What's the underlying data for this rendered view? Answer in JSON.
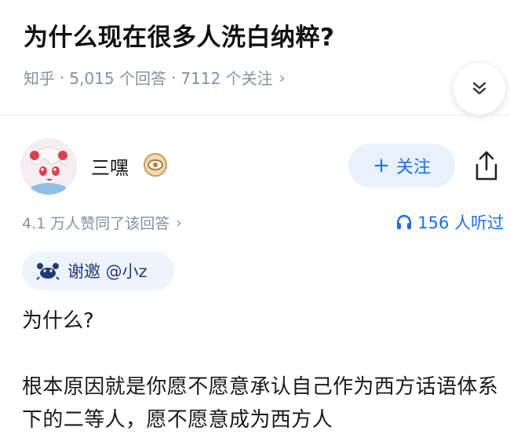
{
  "question": {
    "title": "为什么现在很多人洗白纳粹?",
    "source": "知乎",
    "answers_count": "5,015 个回答",
    "followers": "7112 个关注"
  },
  "author": {
    "name": "三嘿",
    "follow_label": "关注"
  },
  "answer": {
    "approvals": "4.1 万人赞同了该回答",
    "listeners": "156 人听过",
    "invite": "谢邀 @小z",
    "paragraphs": [
      "为什么?",
      "根本原因就是你愿不愿意承认自己作为西方话语体系下的二等人，愿不愿意成为西方人"
    ]
  },
  "colors": {
    "accent": "#1d6fe8",
    "muted": "#8590a6",
    "chip_bg": "#eef4fe",
    "follow_bg": "#e9f1fd"
  },
  "icons": [
    "chevron-right-icon",
    "double-chevron-down-icon",
    "share-icon",
    "headphones-icon",
    "crab-icon",
    "badge-icon"
  ]
}
